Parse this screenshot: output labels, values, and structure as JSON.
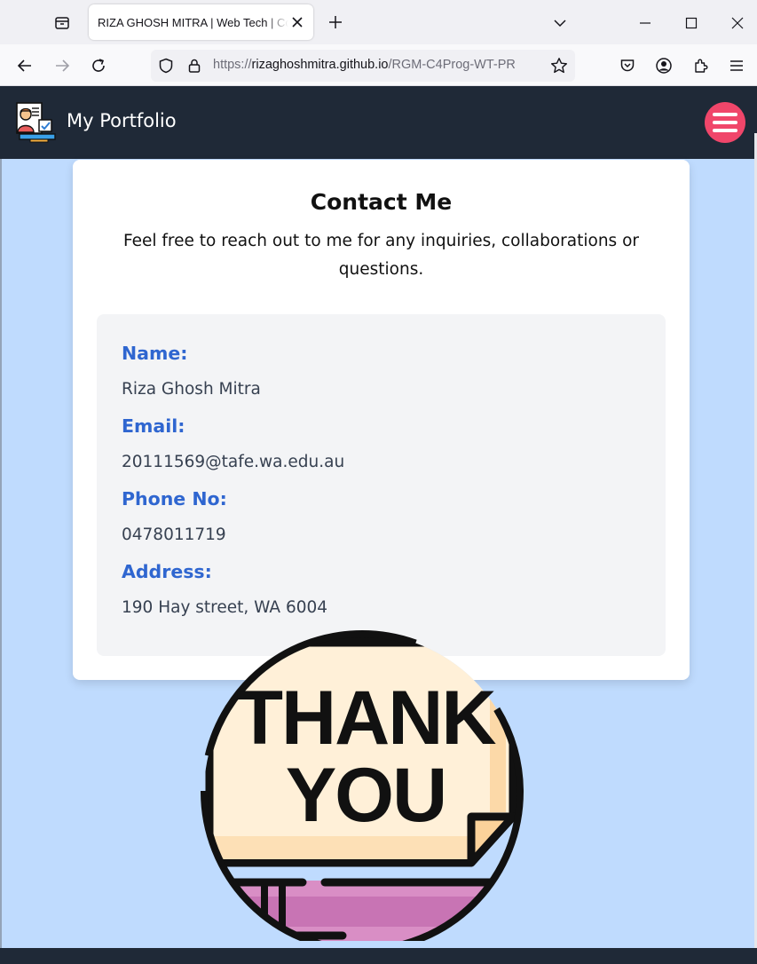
{
  "browser": {
    "tab_title": "RIZA GHOSH MITRA | Web Tech | Contact",
    "url_scheme": "https://",
    "url_host": "rizaghoshmitra.github.io",
    "url_path": "/RGM-C4Prog-WT-PR"
  },
  "header": {
    "title": "My Portfolio"
  },
  "contact": {
    "title": "Contact Me",
    "subtitle": "Feel free to reach out to me for any inquiries, collaborations or questions.",
    "fields": [
      {
        "label": "Name:",
        "value": "Riza Ghosh Mitra"
      },
      {
        "label": "Email:",
        "value": "20111569@tafe.wa.edu.au"
      },
      {
        "label": "Phone No:",
        "value": "0478011719"
      },
      {
        "label": "Address:",
        "value": "190 Hay street, WA 6004"
      }
    ]
  },
  "thanks_image": {
    "line1": "THANK",
    "line2": "YOU"
  },
  "colors": {
    "page_bg": "#bfdbfe",
    "header_bg": "#1f2937",
    "accent_blue": "#2f66d0",
    "menu_button": "#f0466a"
  },
  "icons": [
    "tab-list-icon",
    "close-icon",
    "plus-icon",
    "chevron-down-icon",
    "minimize-icon",
    "maximize-icon",
    "back-icon",
    "forward-icon",
    "reload-icon",
    "shield-icon",
    "lock-icon",
    "star-icon",
    "pocket-icon",
    "account-icon",
    "extensions-icon",
    "menu-icon",
    "hamburger-icon"
  ]
}
